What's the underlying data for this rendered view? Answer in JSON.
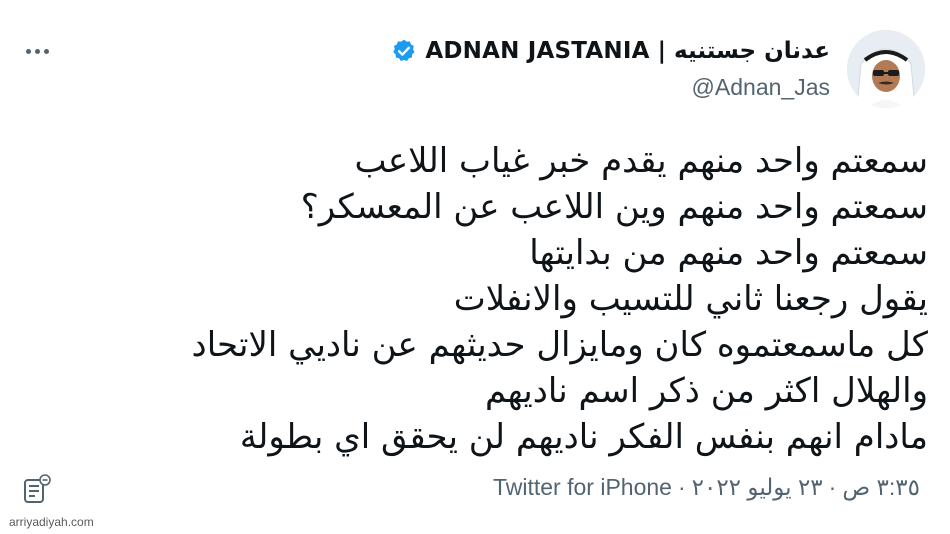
{
  "header": {
    "display_name": "عدنان جستنيه | ADNAN JASTANIA",
    "handle": "@Adnan_Jas"
  },
  "tweet": {
    "lines": [
      "سمعتم واحد منهم يقدم خبر غياب اللاعب",
      "سمعتم واحد منهم وين اللاعب عن المعسكر؟",
      "سمعتم واحد منهم من بدايتها",
      "يقول رجعنا ثاني للتسيب والانفلات",
      "كل ماسمعتموه كان ومايزال حديثهم عن ناديي الاتحاد",
      "والهلال اكثر من ذكر اسم ناديهم",
      "مادام انهم بنفس الفكر ناديهم لن يحقق اي بطولة"
    ]
  },
  "footer": {
    "time": "٣:٣٥ ص",
    "date": "٢٣ يوليو ٢٠٢٢",
    "source": "Twitter for iPhone",
    "separator": "·"
  },
  "watermark": "arriyadiyah.com",
  "icons": {
    "verified": "verified-badge-icon",
    "more": "more-options-icon",
    "notes": "notes-icon"
  },
  "colors": {
    "verified_blue": "#1d9bf0",
    "text_primary": "#0f1419",
    "text_secondary": "#536471"
  }
}
